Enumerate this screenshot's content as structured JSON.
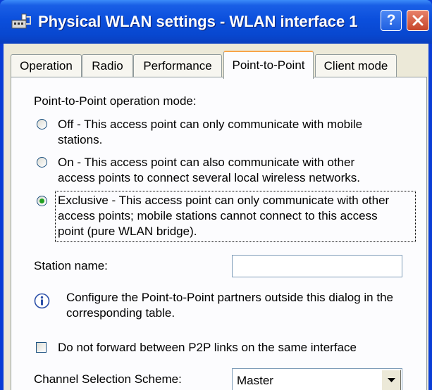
{
  "window": {
    "title": "Physical WLAN settings - WLAN interface 1"
  },
  "titlebar_buttons": {
    "help_label": "?"
  },
  "tabs": [
    {
      "label": "Operation",
      "active": false
    },
    {
      "label": "Radio",
      "active": false
    },
    {
      "label": "Performance",
      "active": false
    },
    {
      "label": "Point-to-Point",
      "active": true
    },
    {
      "label": "Client mode",
      "active": false
    }
  ],
  "p2p": {
    "mode_heading": "Point-to-Point operation mode:",
    "options": [
      {
        "lines": [
          "Off - This access point can only communicate with mobile",
          "stations."
        ],
        "checked": false
      },
      {
        "lines": [
          "On - This access point can also communicate with other",
          "access points to connect several local wireless networks."
        ],
        "checked": false
      },
      {
        "lines": [
          "Exclusive - This access point can only communicate with other",
          "access points; mobile stations cannot connect to this access",
          "point (pure WLAN bridge)."
        ],
        "checked": true
      }
    ],
    "station_name_label": "Station name:",
    "station_name_value": "",
    "info_lines": [
      "Configure the Point-to-Point partners outside this dialog in the",
      "corresponding table."
    ],
    "no_forward_label": "Do not forward between P2P links on the same interface",
    "no_forward_checked": false,
    "channel_scheme_label": "Channel Selection Scheme:",
    "channel_scheme_value": "Master"
  },
  "colors": {
    "titlebar": "#0b4fdc",
    "dialog_bg": "#ece9d8",
    "tab_highlight": "#f9a54a",
    "close_button": "#c6452a"
  },
  "icons": {
    "app": "network-plug-icon",
    "help": "help-icon",
    "close": "close-icon",
    "info": "info-icon",
    "dropdown": "chevron-down-icon"
  }
}
